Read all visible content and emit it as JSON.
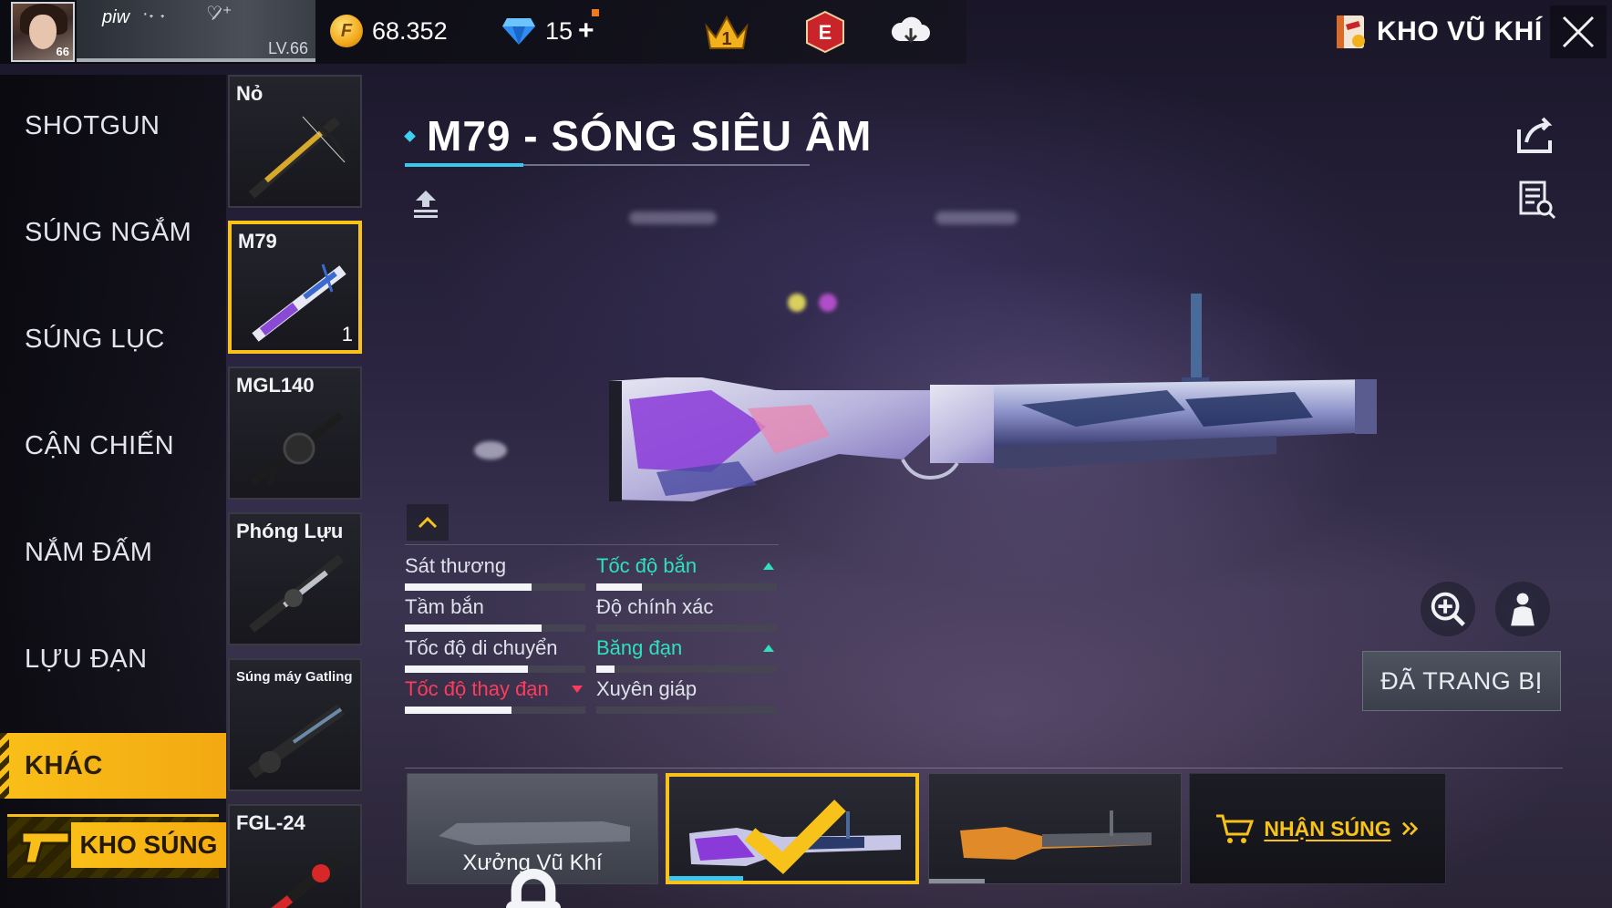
{
  "player": {
    "name": "piw",
    "avatar_level": "66",
    "level_text": "LV.66"
  },
  "currency": {
    "gold": "68.352",
    "diamonds": "15",
    "diamond_plus": "+"
  },
  "top_icons": {
    "rank_number": "1",
    "elite_letter": "E"
  },
  "vault_title": "KHO VŨ KHÍ",
  "categories": [
    "SHOTGUN",
    "SÚNG NGẮM",
    "SÚNG LỤC",
    "CẬN CHIẾN",
    "NẮM ĐẤM",
    "LỰU ĐẠN",
    "KHÁC"
  ],
  "active_category": "KHÁC",
  "armory_button": "KHO SÚNG",
  "weapons": [
    {
      "label": "Nỏ",
      "count": ""
    },
    {
      "label": "M79",
      "count": "1"
    },
    {
      "label": "MGL140",
      "count": ""
    },
    {
      "label": "Phóng Lựu",
      "count": ""
    },
    {
      "label": "Súng máy Gatling",
      "count": ""
    },
    {
      "label": "FGL-24",
      "count": ""
    }
  ],
  "weapon_title": "M79 - SÓNG SIÊU ÂM",
  "stats": [
    {
      "label": "Sát thương",
      "value": 0.7,
      "trend": "none"
    },
    {
      "label": "Tốc độ bắn",
      "value": 0.25,
      "trend": "up"
    },
    {
      "label": "Tầm bắn",
      "value": 0.76,
      "trend": "none"
    },
    {
      "label": "Độ chính xác",
      "value": 0.0,
      "trend": "none"
    },
    {
      "label": "Tốc độ di chuyển",
      "value": 0.68,
      "trend": "none"
    },
    {
      "label": "Băng đạn",
      "value": 0.1,
      "trend": "up"
    },
    {
      "label": "Tốc độ thay đạn",
      "value": 0.59,
      "trend": "down"
    },
    {
      "label": "Xuyên giáp",
      "value": 0.0,
      "trend": "none"
    }
  ],
  "equipped_label": "ĐÃ TRANG BỊ",
  "workshop_label": "Xưởng Vũ Khí",
  "get_gun_label": "NHẬN SÚNG",
  "colors": {
    "accent_yellow": "#f7c21a",
    "accent_cyan": "#39c8ec",
    "stat_up": "#2fe0c0",
    "stat_down": "#ff3b5c"
  }
}
